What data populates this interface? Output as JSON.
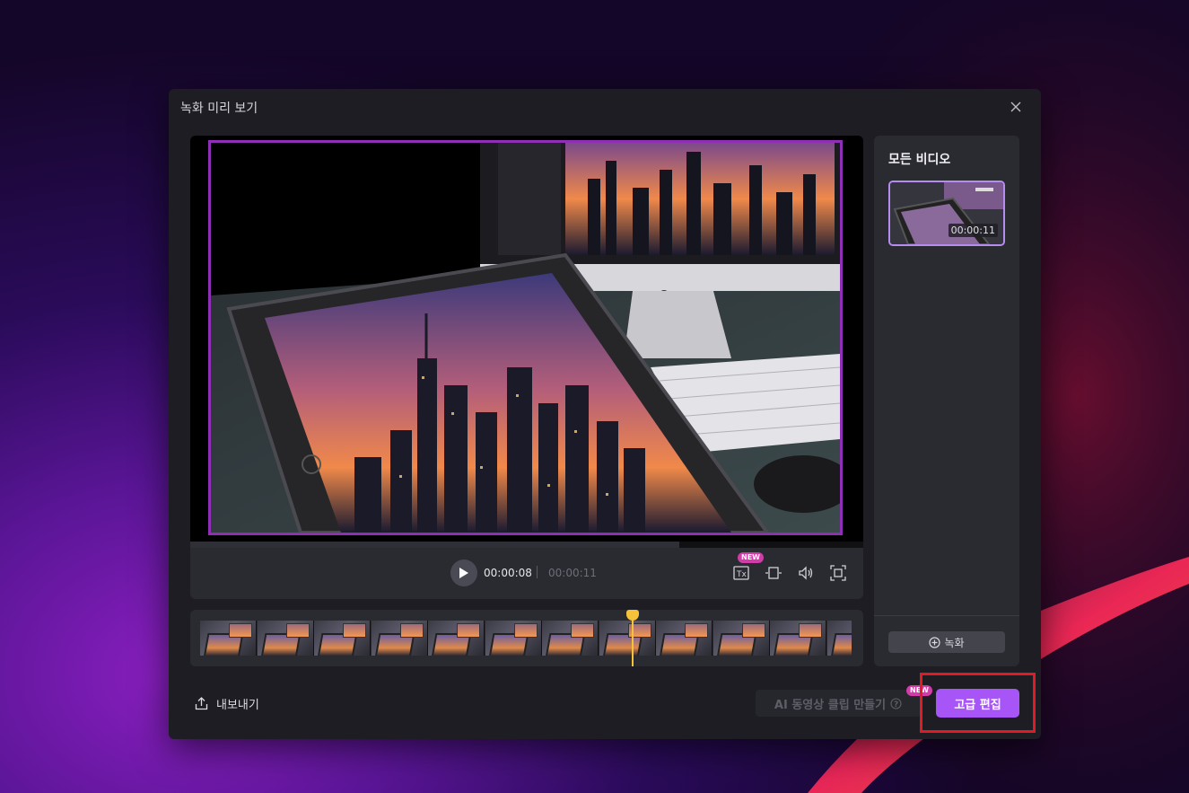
{
  "dialog": {
    "title": "녹화 미리 보기",
    "close_icon": "close-icon"
  },
  "player": {
    "current_time": "00:00:08",
    "total_time": "00:00:11",
    "progress_fraction": 0.727,
    "new_badge": "NEW",
    "icons": [
      "play-icon",
      "caption-icon",
      "crop-icon",
      "volume-icon",
      "fullscreen-icon"
    ]
  },
  "timeline": {
    "thumbnail_count": 12,
    "playhead_fraction": 0.662
  },
  "side_panel": {
    "title": "모든 비디오",
    "videos": [
      {
        "duration": "00:00:11",
        "selected": true
      }
    ],
    "record_label": "녹화",
    "record_icon": "plus-circle-icon"
  },
  "footer": {
    "export_label": "내보내기",
    "export_icon": "share-icon",
    "ai_clip_label": "AI 동영상 클립 만들기",
    "ai_new_badge": "NEW",
    "advanced_edit_label": "고급 편집"
  },
  "colors": {
    "accent": "#a855f7",
    "highlight": "#e01b24",
    "playhead": "#f6c23a",
    "badge": "#d13da8"
  }
}
